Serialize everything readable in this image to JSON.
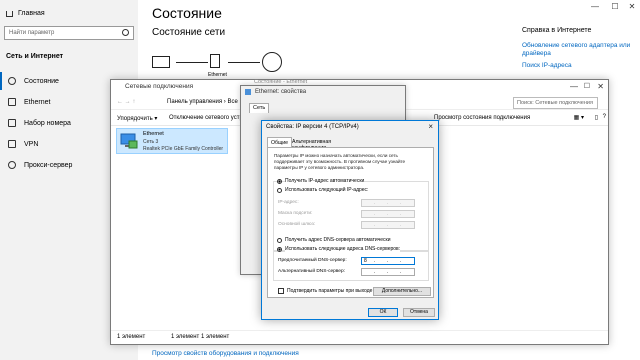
{
  "settings": {
    "home": "Главная",
    "search_placeholder": "Найти параметр",
    "section": "Сеть и Интернет",
    "nav": [
      {
        "label": "Состояние",
        "icon": "globe-icon"
      },
      {
        "label": "Ethernet",
        "icon": "ethernet-icon"
      },
      {
        "label": "Набор номера",
        "icon": "dialup-icon"
      },
      {
        "label": "VPN",
        "icon": "vpn-icon"
      },
      {
        "label": "Прокси-сервер",
        "icon": "proxy-icon"
      }
    ],
    "title": "Состояние",
    "subtitle": "Состояние сети",
    "diagram_label": "Ethernet",
    "help": {
      "title": "Справка в Интернете",
      "links": [
        "Обновление сетевого адаптера или драйвера",
        "Поиск IP-адреса"
      ]
    },
    "bottom_link": "Просмотр свойств оборудования и подключения"
  },
  "explorer": {
    "title": "Сетевые подключения",
    "breadcrumb": "Панель управления  ›  Все",
    "search_placeholder": "Поиск: Сетевые подключения",
    "toolbar": {
      "organize": "Упорядочить ▾",
      "disconnect": "Отключение сетевого устро",
      "view_status": "Просмотр состояния подключения"
    },
    "item": {
      "name": "Ethernet",
      "network": "Сеть 3",
      "adapter": "Realtek PCIe GbE Family Controller"
    },
    "status_left": "1 элемент",
    "status_right": "1 элемент  1 элемент"
  },
  "status_window": {
    "title": "Состояние - Ethernet"
  },
  "eth_props": {
    "title": "Ethernet: свойства",
    "tab": "Сеть"
  },
  "ipv4": {
    "title": "Свойства: IP версии 4 (TCP/IPv4)",
    "close": "×",
    "tabs": [
      "Общие",
      "Альтернативная конфигурация"
    ],
    "description": "Параметры IP можно назначать автоматически, если сеть поддерживает эту возможность. В противном случае узнайте параметры IP у сетевого администратора.",
    "ip_auto": "Получить IP-адрес автоматически",
    "ip_manual": "Использовать следующий IP-адрес:",
    "ip_fields": [
      "IP-адрес:",
      "Маска подсети:",
      "Основной шлюз:"
    ],
    "dns_auto": "Получить адрес DNS-сервера автоматически",
    "dns_manual": "Использовать следующие адреса DNS-серверов:",
    "dns_fields": [
      "Предпочитаемый DNS-сервер:",
      "Альтернативный DNS-сервер:"
    ],
    "preferred_dns_value": "8",
    "validate": "Подтвердить параметры при выходе",
    "advanced": "Дополнительно...",
    "ok": "ОК",
    "cancel": "Отмена"
  }
}
